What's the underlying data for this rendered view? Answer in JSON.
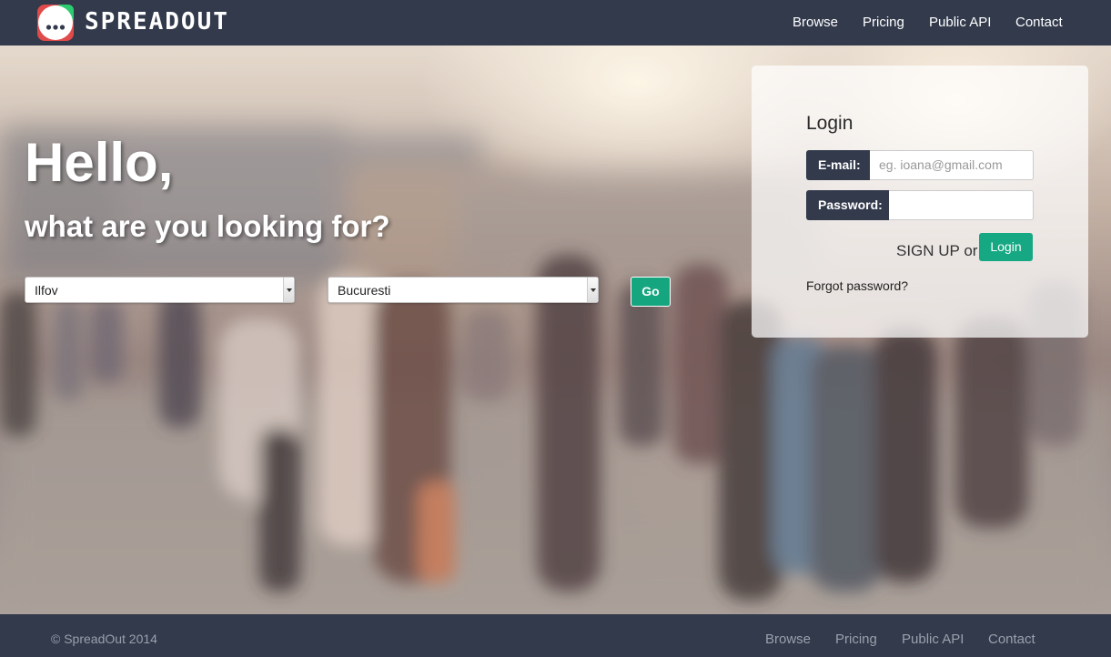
{
  "brand": {
    "name": "SPREADOUT"
  },
  "nav": {
    "items": [
      {
        "label": "Browse"
      },
      {
        "label": "Pricing"
      },
      {
        "label": "Public API"
      },
      {
        "label": "Contact"
      }
    ]
  },
  "hero": {
    "title": "Hello,",
    "subtitle": "what are you looking for?",
    "county_select": {
      "value": "Ilfov"
    },
    "city_select": {
      "value": "Bucuresti"
    },
    "go_label": "Go"
  },
  "login": {
    "title": "Login",
    "email_label": "E-mail:",
    "email_placeholder": "eg. ioana@gmail.com",
    "password_label": "Password:",
    "password_value": "",
    "signup_text": "SIGN UP or",
    "login_label": "Login",
    "forgot_label": "Forgot password?"
  },
  "footer": {
    "copyright": "© SpreadOut 2014",
    "items": [
      {
        "label": "Browse"
      },
      {
        "label": "Pricing"
      },
      {
        "label": "Public API"
      },
      {
        "label": "Contact"
      }
    ]
  },
  "colors": {
    "navbar": "#323a4c",
    "accent": "#16a882",
    "logo_accent": "#2ecc71"
  }
}
